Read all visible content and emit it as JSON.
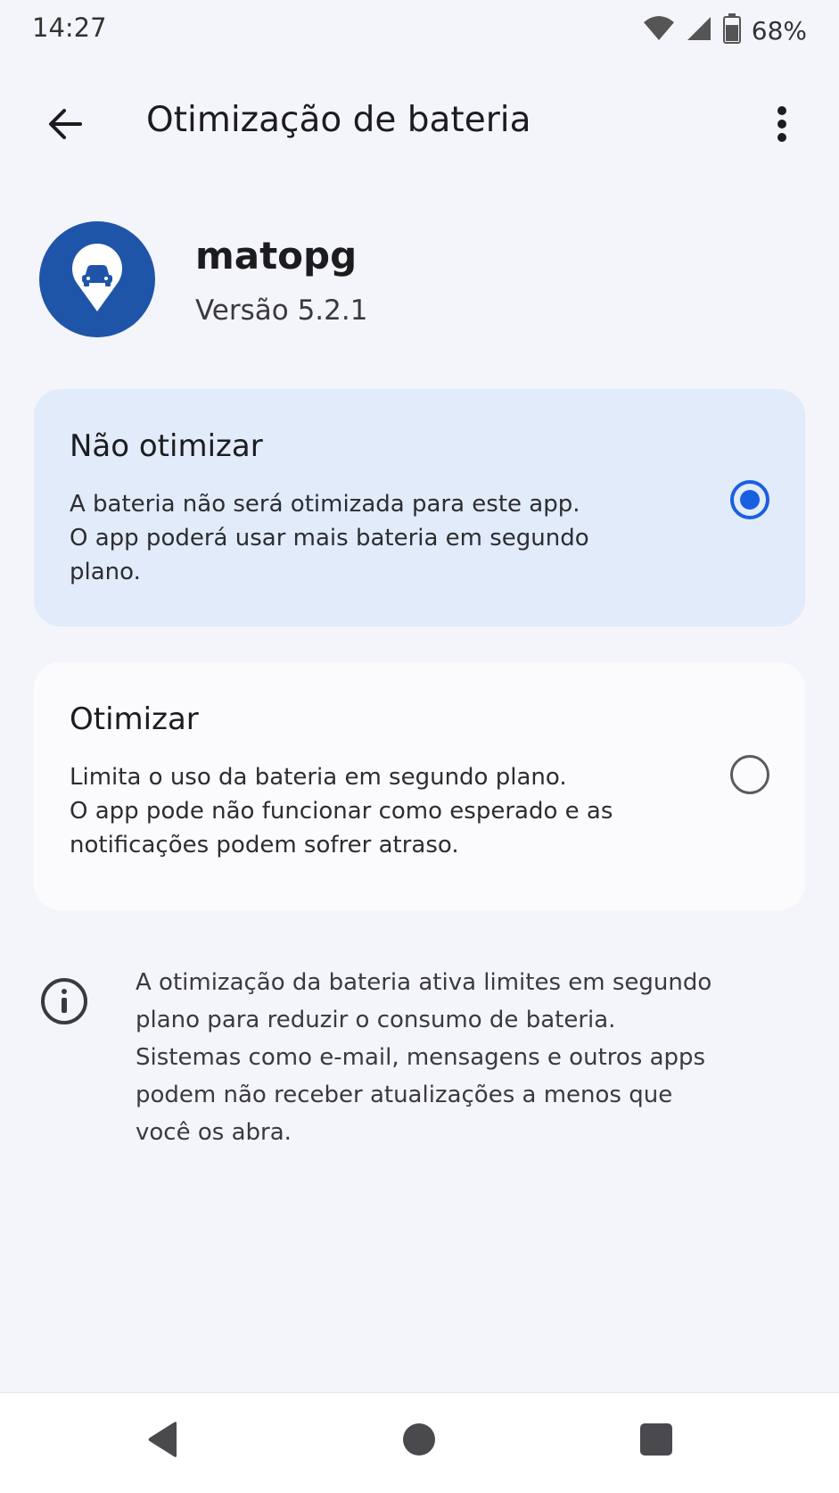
{
  "status_bar": {
    "time": "14:27",
    "battery_percent": "68%",
    "icons": [
      "wifi-icon",
      "signal-icon",
      "battery-icon"
    ]
  },
  "app_bar": {
    "title": "Otimização de bateria",
    "back_icon": "arrow-left-icon",
    "menu_icon": "more-vert-icon"
  },
  "app": {
    "name": "matopg",
    "version": "Versão 5.2.1",
    "icon": "location-pin-car-icon",
    "icon_color": "#1f55a8"
  },
  "options": [
    {
      "title": "Não otimizar",
      "description_lines": [
        "A bateria não será otimizada para este app.",
        "O app poderá usar mais bateria em segundo",
        "plano."
      ],
      "selected": true
    },
    {
      "title": "Otimizar",
      "description_lines": [
        "Limita o uso da bateria em segundo plano.",
        "O app pode não funcionar como esperado e as",
        "notificações podem sofrer atraso."
      ],
      "selected": false
    }
  ],
  "info": {
    "icon": "info-icon",
    "lines": [
      "A otimização da bateria ativa limites em segundo",
      "plano para reduzir o consumo de bateria.",
      "Sistemas como e-mail, mensagens e outros apps",
      "podem não receber atualizações a menos que",
      "você os abra."
    ]
  },
  "nav_bar": {
    "icons": [
      "nav-back-icon",
      "nav-home-icon",
      "nav-recents-icon"
    ]
  },
  "colors": {
    "accent": "#1a5fe0",
    "selected_card_bg": "#e1ebfa",
    "page_bg": "#f4f5fa"
  }
}
